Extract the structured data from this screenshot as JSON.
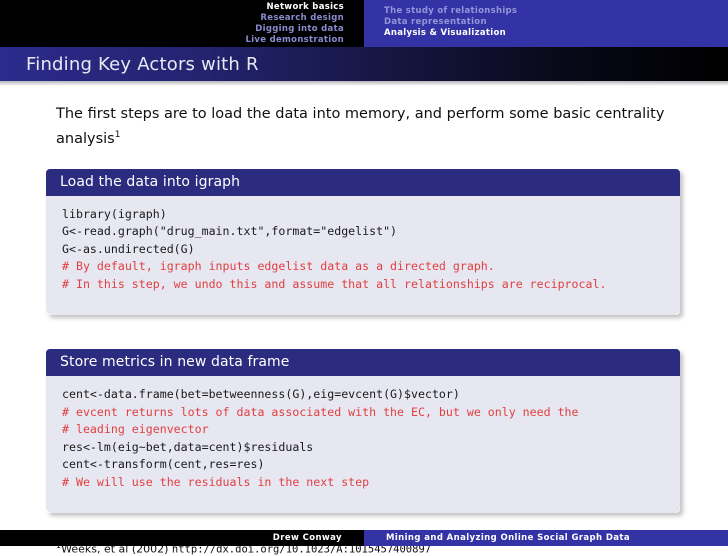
{
  "header": {
    "left_nav": [
      {
        "label": "Network basics",
        "active": true
      },
      {
        "label": "Research design",
        "active": false
      },
      {
        "label": "Digging into data",
        "active": false
      },
      {
        "label": "Live demonstration",
        "active": false
      }
    ],
    "right_nav": [
      {
        "label": "The study of relationships",
        "active": false
      },
      {
        "label": "Data representation",
        "active": false
      },
      {
        "label": "Analysis & Visualization",
        "active": true
      }
    ],
    "accent_blue": "#3333a6",
    "nav_inactive_color": "#8a8ad0",
    "nav_active_color": "#ffffff"
  },
  "title": {
    "text": "Finding Key Actors with R"
  },
  "intro": {
    "text": "The first steps are to load the data into memory, and perform some basic centrality analysis",
    "footnote_marker": "1"
  },
  "blocks": [
    {
      "title": "Load the data into igraph",
      "lines": [
        {
          "text": "library(igraph)",
          "comment": false
        },
        {
          "text": "G<-read.graph(\"drug_main.txt\",format=\"edgelist\")",
          "comment": false
        },
        {
          "text": "G<-as.undirected(G)",
          "comment": false
        },
        {
          "text": "# By default, igraph inputs edgelist data as a directed graph.",
          "comment": true
        },
        {
          "text": "# In this step, we undo this and assume that all relationships are reciprocal.",
          "comment": true
        }
      ]
    },
    {
      "title": "Store metrics in new data frame",
      "lines": [
        {
          "text": "cent<-data.frame(bet=betweenness(G),eig=evcent(G)$vector)",
          "comment": false
        },
        {
          "text": "# evcent returns lots of data associated with the EC, but we only need the",
          "comment": true
        },
        {
          "text": "# leading eigenvector",
          "comment": true
        },
        {
          "text": "res<-lm(eig~bet,data=cent)$residuals",
          "comment": false
        },
        {
          "text": "cent<-transform(cent,res=res)",
          "comment": false
        },
        {
          "text": "# We will use the residuals in the next step",
          "comment": true
        }
      ]
    }
  ],
  "footnote": {
    "marker": "1",
    "citation": "Weeks, et al (2002) ",
    "url": "http://dx.doi.org/10.1023/A:1015457400897"
  },
  "footer": {
    "author": "Drew Conway",
    "talk_title": "Mining and Analyzing Online Social Graph Data"
  },
  "colors": {
    "block_header": "#2b2b80",
    "block_body": "#e7e7f2",
    "comment_red": "#e04040",
    "title_bar_start": "#2b2b8c",
    "title_bar_end": "#000000"
  }
}
